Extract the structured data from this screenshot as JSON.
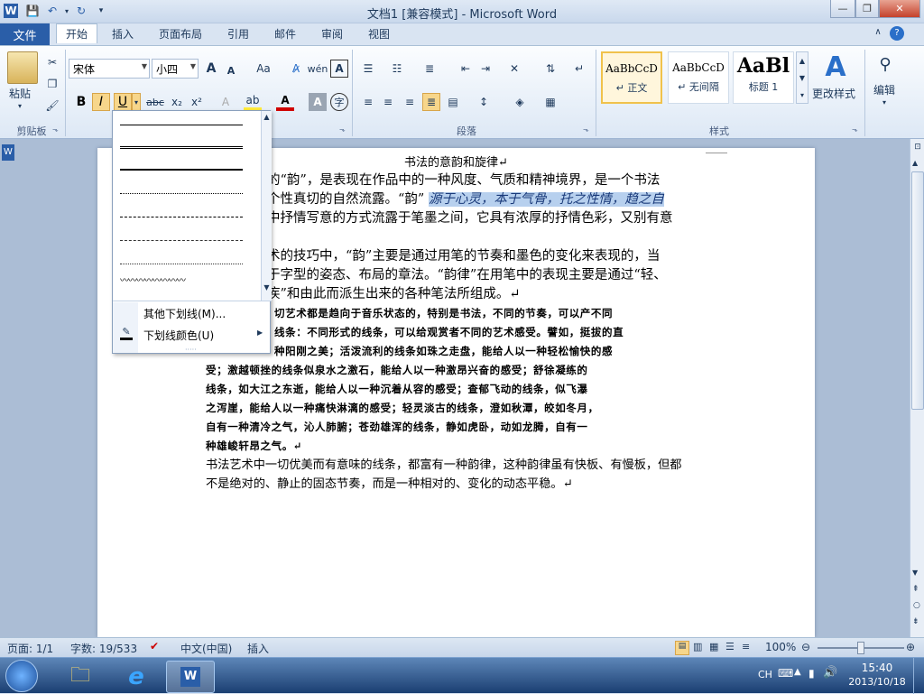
{
  "window": {
    "title": "文档1 [兼容模式] - Microsoft Word"
  },
  "tabs": {
    "file": "文件",
    "home": "开始",
    "insert": "插入",
    "layout": "页面布局",
    "references": "引用",
    "mailings": "邮件",
    "review": "审阅",
    "view": "视图"
  },
  "ribbon": {
    "clipboard": {
      "label": "剪贴板",
      "paste": "粘贴"
    },
    "font": {
      "font_name": "宋体",
      "font_size": "小四",
      "bold": "B",
      "italic": "I",
      "underline": "U",
      "grow": "A",
      "shrink": "A",
      "case": "Aa",
      "strike": "abc",
      "sub": "x₂",
      "sup": "x²"
    },
    "paragraph": {
      "label": "段落"
    },
    "styles": {
      "label": "样式",
      "items": [
        {
          "preview": "AaBbCcD",
          "name": "↵ 正文"
        },
        {
          "preview": "AaBbCcD",
          "name": "↵ 无间隔"
        },
        {
          "preview": "AaBl",
          "name": "标题 1"
        }
      ],
      "change": "更改样式"
    },
    "editing": {
      "label": "编辑"
    }
  },
  "underline_menu": {
    "more": "其他下划线(M)...",
    "color": "下划线颜色(U)"
  },
  "document": {
    "title": "书法的意韵和旋律↵",
    "p1": [
      "的“韵”，是表现在作品中的一种风度、气质和精神境界，是一个书法",
      "个性真切的自然流露。“韵”",
      "中抒情写意的方式流露于笔墨之间，它具有浓厚的抒情色彩，又别有意"
    ],
    "p1_highlight": "源于心灵，本于气骨，托之性情，趋之自",
    "p2": [
      "术的技巧中，“韵”主要是通过用笔的节奏和墨色的变化来表现的，当",
      "于字型的姿态、布局的章法。“韵律”在用笔中的表现主要是通过“轻、",
      "疾”和由此而派生出来的各种笔法所组成。↵"
    ],
    "p3": [
      "切艺术都是趋向于音乐状态的，特别是书法，不同的节奏，可以产不同",
      "线条：不同形式的线条，可以给观赏者不同的艺术感受。譬如，挺拔的直",
      "种阳刚之美；活泼流利的线条如珠之走盘，能给人以一种轻松愉快的感",
      "受；激越顿挫的线条似泉水之激石，能给人以一种激昂兴奋的感受；舒徐凝练的",
      "线条，如大江之东逝，能给人以一种沉着从容的感受；查郁飞动的线条，似飞瀑",
      "之泻崖，能给人以一种痛快淋漓的感受；轻灵淡古的线条，澄如秋潭，皎如冬月，",
      "自有一种清冷之气，沁人肺腑；苍劲雄浑的线条，静如虎卧，动如龙腾，自有一",
      "种雄峻轩昂之气。↵"
    ],
    "p4": [
      "书法艺术中一切优美而有意味的线条，都富有一种韵律，这种韵律虽有快板、有慢板，但都",
      "不是绝对的、静止的固态节奏，而是一种相对的、变化的动态平稳。↵"
    ]
  },
  "status": {
    "page": "页面: 1/1",
    "words": "字数: 19/533",
    "lang": "中文(中国)",
    "insert": "插入",
    "zoom": "100%"
  },
  "taskbar": {
    "time": "15:40",
    "date": "2013/10/18",
    "lang": "CH"
  }
}
